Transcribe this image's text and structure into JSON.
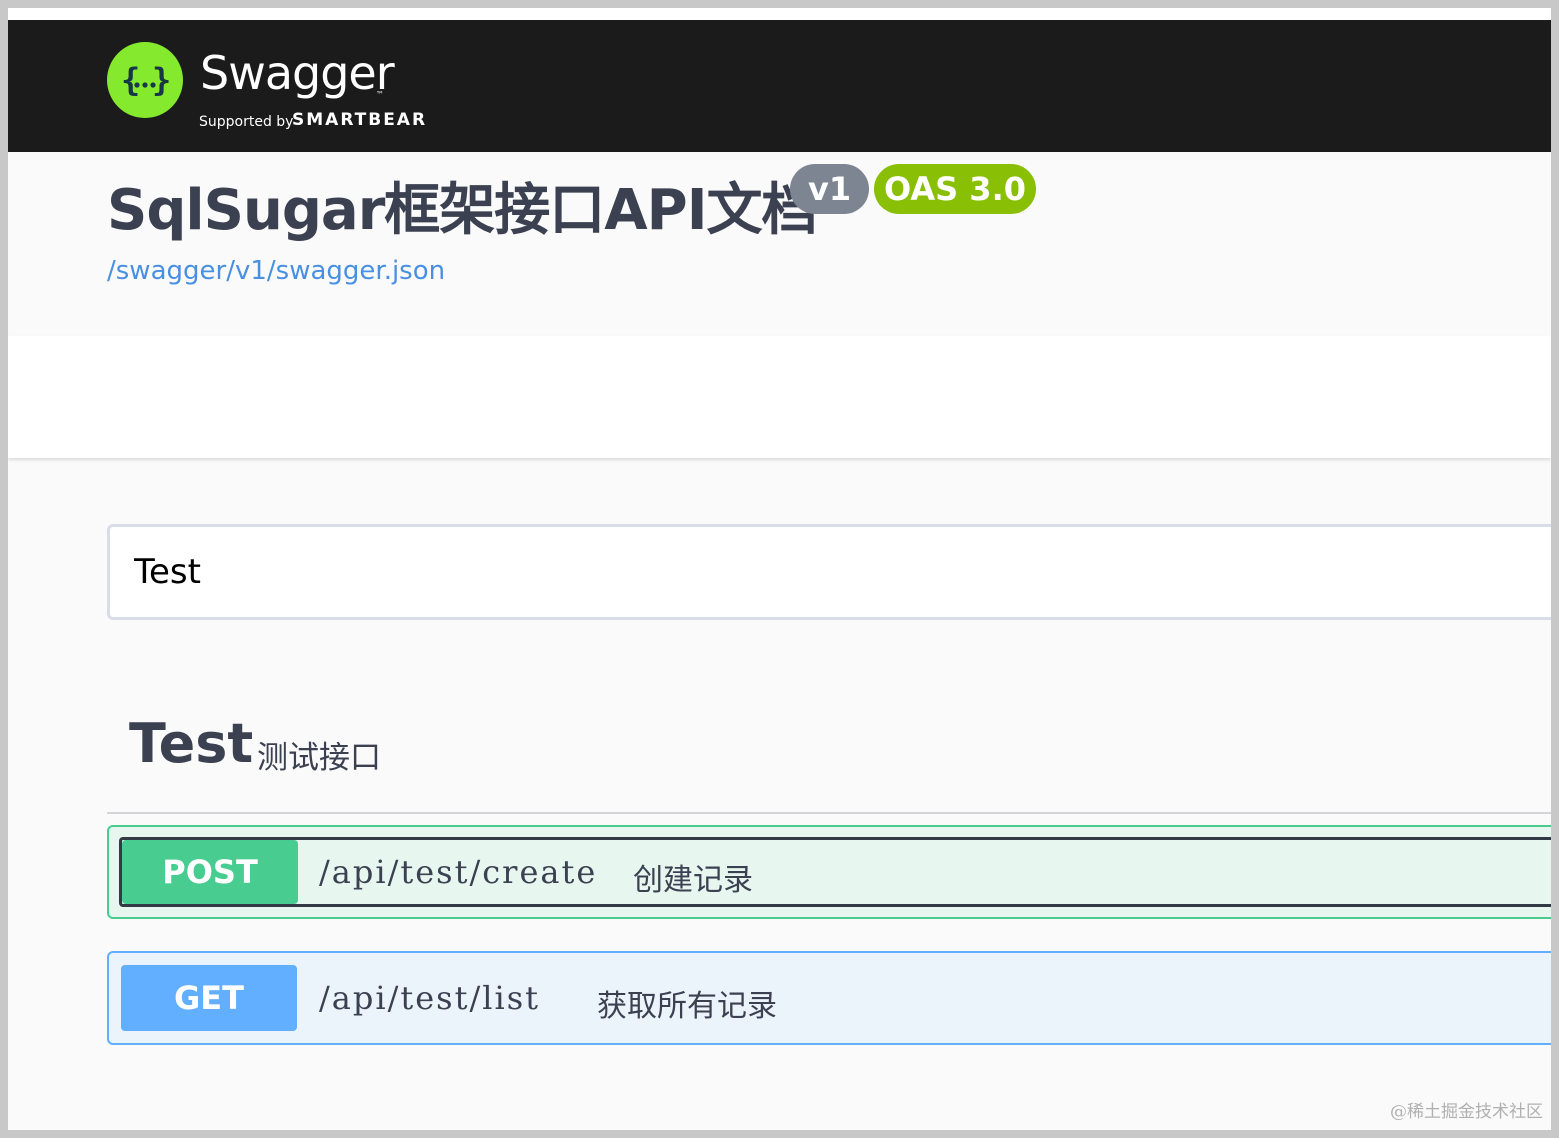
{
  "topbar": {
    "brand_name": "Swagger",
    "trademark": "™",
    "supported_by": "Supported by",
    "company": "SMARTBEAR",
    "logo_icon": "swagger-braces-icon",
    "logo_color": "#85ea2d"
  },
  "info": {
    "title": "SqlSugar框架接口API文档",
    "version_badge": "v1",
    "oas_badge": "OAS 3.0",
    "spec_url": "/swagger/v1/swagger.json"
  },
  "filter": {
    "value": "Test"
  },
  "tag": {
    "name": "Test",
    "description": "测试接口"
  },
  "operations": [
    {
      "method": "POST",
      "path": "/api/test/create",
      "summary": "创建记录",
      "color": "#49cc90"
    },
    {
      "method": "GET",
      "path": "/api/test/list",
      "summary": "获取所有记录",
      "color": "#61affe"
    }
  ],
  "watermark": "@稀土掘金技术社区"
}
